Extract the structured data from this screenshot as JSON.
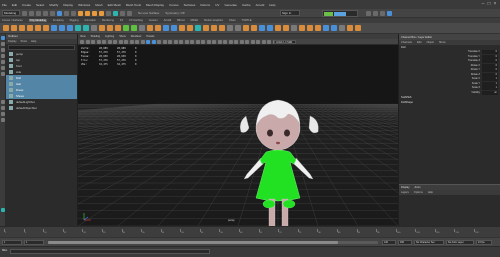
{
  "menubar": {
    "items": [
      "File",
      "Edit",
      "Create",
      "Select",
      "Modify",
      "Display",
      "Windows",
      "Mesh",
      "Edit Mesh",
      "Mesh Tools",
      "Mesh Display",
      "Curves",
      "Surfaces",
      "Deform",
      "UV",
      "Generate",
      "Cache",
      "Arnold",
      "Help"
    ],
    "user": "Sign In"
  },
  "statusline": {
    "mode": "Modeling",
    "no_live": "No Live Surface",
    "symmetry": "Symmetry: Off"
  },
  "shelf": {
    "tabs": [
      "Curves / Surfaces",
      "Poly Modeling",
      "Sculpting",
      "Rigging",
      "Animation",
      "Rendering",
      "FX",
      "FX Caching",
      "Custom",
      "Arnold",
      "Bifrost",
      "MASH",
      "Motion Graphics",
      "XGen",
      "TURTLE"
    ],
    "active_tab": "Poly Modeling"
  },
  "outliner": {
    "title": "Outliner",
    "menu": [
      "Display",
      "Show",
      "Help"
    ],
    "items": [
      {
        "label": "persp",
        "selected": false
      },
      {
        "label": "top",
        "selected": false
      },
      {
        "label": "front",
        "selected": false
      },
      {
        "label": "side",
        "selected": false
      },
      {
        "label": "Doll",
        "selected": true
      },
      {
        "label": "Hair",
        "selected": true
      },
      {
        "label": "Dress",
        "selected": true
      },
      {
        "label": "Shoes",
        "selected": true
      },
      {
        "label": "defaultLightSet",
        "selected": false
      },
      {
        "label": "defaultObjectSet",
        "selected": false
      }
    ]
  },
  "viewport": {
    "menu": [
      "View",
      "Shading",
      "Lighting",
      "Show",
      "Renderer",
      "Panels"
    ],
    "camera_select": "ACES 1.0 SDR",
    "camera_label": "persp",
    "hud": [
      {
        "label": "Verts:",
        "a": "28,689",
        "b": "28,689",
        "c": "0"
      },
      {
        "label": "Edges:",
        "a": "57,270",
        "b": "57,270",
        "c": "0"
      },
      {
        "label": "Faces:",
        "a": "28,638",
        "b": "28,638",
        "c": "0"
      },
      {
        "label": "Tris:",
        "a": "57,276",
        "b": "57,276",
        "c": "0"
      },
      {
        "label": "UVs:",
        "a": "32,475",
        "b": "32,475",
        "c": "0"
      }
    ]
  },
  "channelbox": {
    "tabs": [
      "Channel Box / Layer Editor"
    ],
    "menu": [
      "Channels",
      "Edit",
      "Object",
      "Show"
    ],
    "node": "Doll",
    "attributes": [
      {
        "label": "Translate X",
        "value": "0"
      },
      {
        "label": "Translate Y",
        "value": "0"
      },
      {
        "label": "Translate Z",
        "value": "0"
      },
      {
        "label": "Rotate X",
        "value": "0"
      },
      {
        "label": "Rotate Y",
        "value": "0"
      },
      {
        "label": "Rotate Z",
        "value": "0"
      },
      {
        "label": "Scale X",
        "value": "1"
      },
      {
        "label": "Scale Y",
        "value": "1"
      },
      {
        "label": "Scale Z",
        "value": "1"
      },
      {
        "label": "Visibility",
        "value": "on"
      }
    ],
    "shapes_title": "SHAPES",
    "shape_node": "DollShape",
    "layer_tabs": [
      "Display",
      "Anim"
    ],
    "layer_menu": [
      "Layers",
      "Options",
      "Help"
    ]
  },
  "timeslider": {
    "ticks": [
      "1",
      "5",
      "10",
      "15",
      "20",
      "25",
      "30",
      "35",
      "40",
      "45",
      "50",
      "55",
      "60",
      "65",
      "70",
      "75",
      "80",
      "85",
      "90",
      "95",
      "100",
      "105",
      "110",
      "115",
      "120"
    ]
  },
  "rangebar": {
    "start": "1",
    "start_inner": "1",
    "end_inner": "120",
    "end": "200",
    "char_set": "No Character Set",
    "anim_layer": "No Anim Layer",
    "fps": "24 fps"
  },
  "cmdline": {
    "label": "MEL"
  },
  "colors": {
    "selection": "#5285a6",
    "dress": "#20e020",
    "wire": "#dddddd",
    "viewport_bg": "#1b1b1b"
  }
}
